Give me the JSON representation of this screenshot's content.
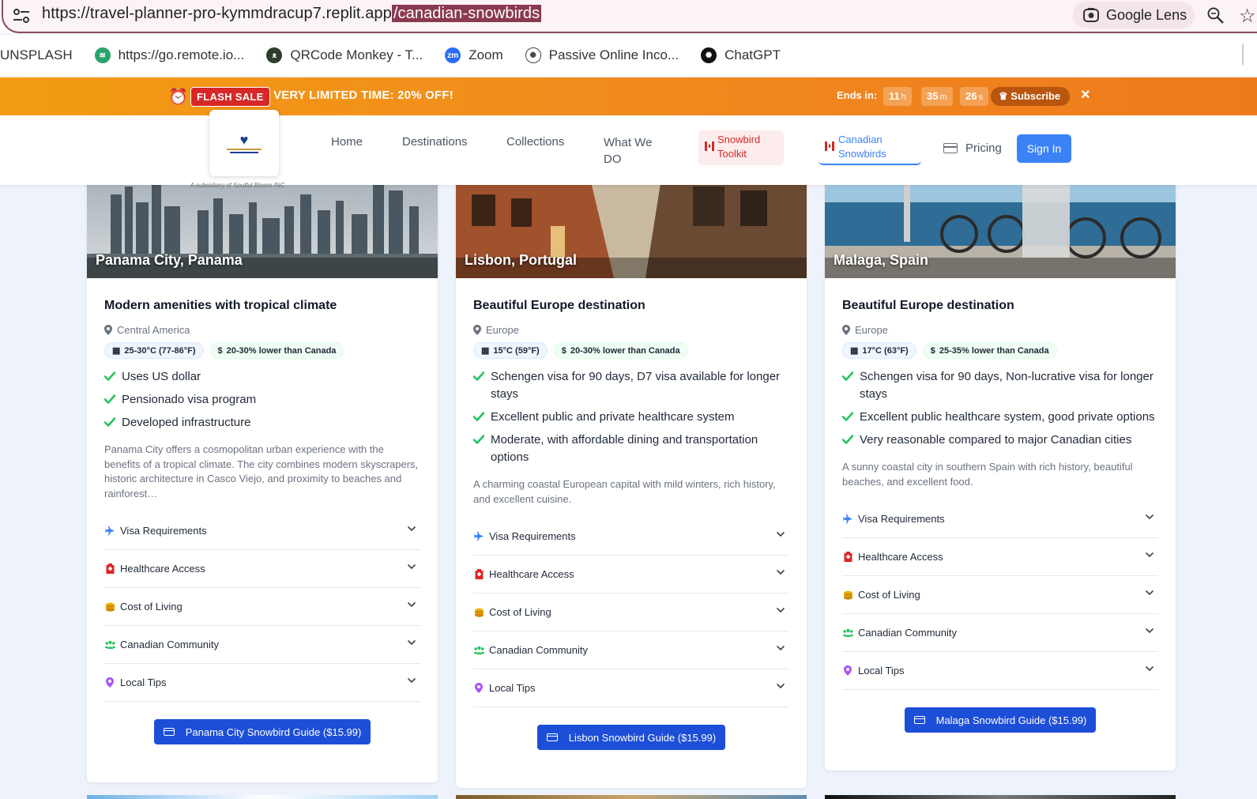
{
  "browser": {
    "url_main": "https://travel-planner-pro-kymmdracup7.replit.app",
    "url_path": "/canadian-snowbirds",
    "lens_label": "Google Lens",
    "bookmarks": [
      {
        "label": "UNSPLASH",
        "icon": "none"
      },
      {
        "label": "https://go.remote.io...",
        "icon": "remote-icon"
      },
      {
        "label": "QRCode Monkey - T...",
        "icon": "monkey-icon"
      },
      {
        "label": "Zoom",
        "icon": "zoom-icon"
      },
      {
        "label": "Passive Online Inco...",
        "icon": "openai-icon"
      },
      {
        "label": "ChatGPT",
        "icon": "chatgpt-icon"
      }
    ]
  },
  "sale": {
    "badge": "FLASH SALE",
    "text": "VERY LIMITED TIME:  20% OFF!",
    "ends_label": "Ends in:",
    "hours": "11",
    "hours_unit": "h",
    "minutes": "35",
    "minutes_unit": "m",
    "seconds": "26",
    "seconds_unit": "s",
    "subscribe": "Subscribe",
    "close": "×"
  },
  "nav": {
    "subsidiary": "A subsidiary of Soulful Bloom INC",
    "home": "Home",
    "destinations": "Destinations",
    "collections": "Collections",
    "what_we_do": "What We DO",
    "toolkit": "Snowbird Toolkit",
    "canadian": "Canadian Snowbirds",
    "pricing": "Pricing",
    "signin": "Sign In"
  },
  "colors": {
    "sale_orange": "#f08a1e",
    "primary_blue": "#3b82f6",
    "guide_blue": "#1d4ed8",
    "check_green": "#22c55e",
    "toolkit_red": "#d62828"
  },
  "cards": [
    {
      "title": "Panama City, Panama",
      "subtitle": "Modern amenities with tropical climate",
      "region": "Central America",
      "temp": "25-30°C (77-86°F)",
      "cost": "20-30% lower than Canada",
      "features": [
        "Uses US dollar",
        "Pensionado visa program",
        "Developed infrastructure"
      ],
      "description": "Panama City offers a cosmopolitan urban experience with the benefits of a tropical climate. The city combines modern skyscrapers, historic architecture in Casco Viejo, and proximity to beaches and rainforest…",
      "accordion": [
        "Visa Requirements",
        "Healthcare Access",
        "Cost of Living",
        "Canadian Community",
        "Local Tips"
      ],
      "guide": "Panama City Snowbird Guide ($15.99)"
    },
    {
      "title": "Lisbon, Portugal",
      "subtitle": "Beautiful Europe destination",
      "region": "Europe",
      "temp": "15°C (59°F)",
      "cost": "20-30% lower than Canada",
      "features": [
        "Schengen visa for 90 days, D7 visa available for longer stays",
        "Excellent public and private healthcare system",
        "Moderate, with affordable dining and transportation options"
      ],
      "description": "A charming coastal European capital with mild winters, rich history, and excellent cuisine.",
      "accordion": [
        "Visa Requirements",
        "Healthcare Access",
        "Cost of Living",
        "Canadian Community",
        "Local Tips"
      ],
      "guide": "Lisbon Snowbird Guide ($15.99)"
    },
    {
      "title": "Malaga, Spain",
      "subtitle": "Beautiful Europe destination",
      "region": "Europe",
      "temp": "17°C (63°F)",
      "cost": "25-35% lower than Canada",
      "features": [
        "Schengen visa for 90 days, Non-lucrative visa for longer stays",
        "Excellent public healthcare system, good private options",
        "Very reasonable compared to major Canadian cities"
      ],
      "description": "A sunny coastal city in southern Spain with rich history, beautiful beaches, and excellent food.",
      "accordion": [
        "Visa Requirements",
        "Healthcare Access",
        "Cost of Living",
        "Canadian Community",
        "Local Tips"
      ],
      "guide": "Malaga Snowbird Guide ($15.99)"
    }
  ]
}
